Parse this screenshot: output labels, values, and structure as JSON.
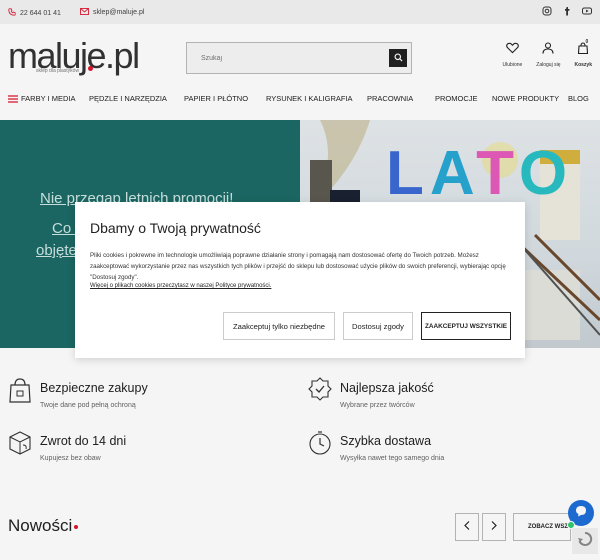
{
  "topbar": {
    "phone": "22 644 01 41",
    "email": "sklep@maluje.pl",
    "social_icons": [
      "instagram-icon",
      "facebook-icon",
      "youtube-icon"
    ]
  },
  "header": {
    "logo_text": "maluje.pl",
    "logo_tagline": "sklep dla plastyków",
    "search_placeholder": "Szukaj",
    "wishlist_label": "Ulubione",
    "login_label": "Zaloguj się",
    "cart_label": "Koszyk",
    "cart_count": "0"
  },
  "nav": {
    "items": [
      "FARBY I MEDIA",
      "PĘDZLE I NARZĘDZIA",
      "PAPIER I PŁÓTNO",
      "RYSUNEK I KALIGRAFIA",
      "PRACOWNIA",
      "PROMOCJE",
      "NOWE PRODUKTY",
      "BLOG"
    ]
  },
  "hero": {
    "line1": "Nie przegap letnich promocji!",
    "line2": "Co t",
    "line3": "objęte",
    "banner_text": [
      "L",
      "A",
      "T",
      "O"
    ]
  },
  "cookie": {
    "title": "Dbamy o Twoją prywatność",
    "description": "Pliki cookies i pokrewne im technologie umożliwiają poprawne działanie strony i pomagają nam dostosować ofertę do Twoich potrzeb. Możesz zaakceptować wykorzystanie przez nas wszystkich tych plików i przejść do sklepu lub dostosować użycie plików do swoich preferencji, wybierając opcję \"Dostosuj zgody\".",
    "more_link": "Więcej o plikach cookies przeczytasz w naszej Polityce prywatności.",
    "btn_necessary": "Zaakceptuj tylko niezbędne",
    "btn_customize": "Dostosuj zgody",
    "btn_accept_all": "ZAAKCEPTUJ WSZYSTKIE"
  },
  "features": [
    {
      "title": "Bezpieczne zakupy",
      "subtitle": "Twoje dane pod pełną ochroną",
      "icon": "lock-bag-icon"
    },
    {
      "title": "Najlepsza jakość",
      "subtitle": "Wybrane przez twórców",
      "icon": "quality-badge-icon"
    },
    {
      "title": "Zwrot do 14 dni",
      "subtitle": "Kupujesz bez obaw",
      "icon": "return-box-icon"
    },
    {
      "title": "Szybka dostawa",
      "subtitle": "Wysyłka nawet tego samego dnia",
      "icon": "delivery-timer-icon"
    }
  ],
  "section": {
    "title": "Nowości",
    "see_all": "ZOBACZ WSZYSTKIE"
  },
  "colors": {
    "accent_red": "#e0152d",
    "hero_teal": "#1d6b66",
    "chat_blue": "#1e6fd9"
  }
}
